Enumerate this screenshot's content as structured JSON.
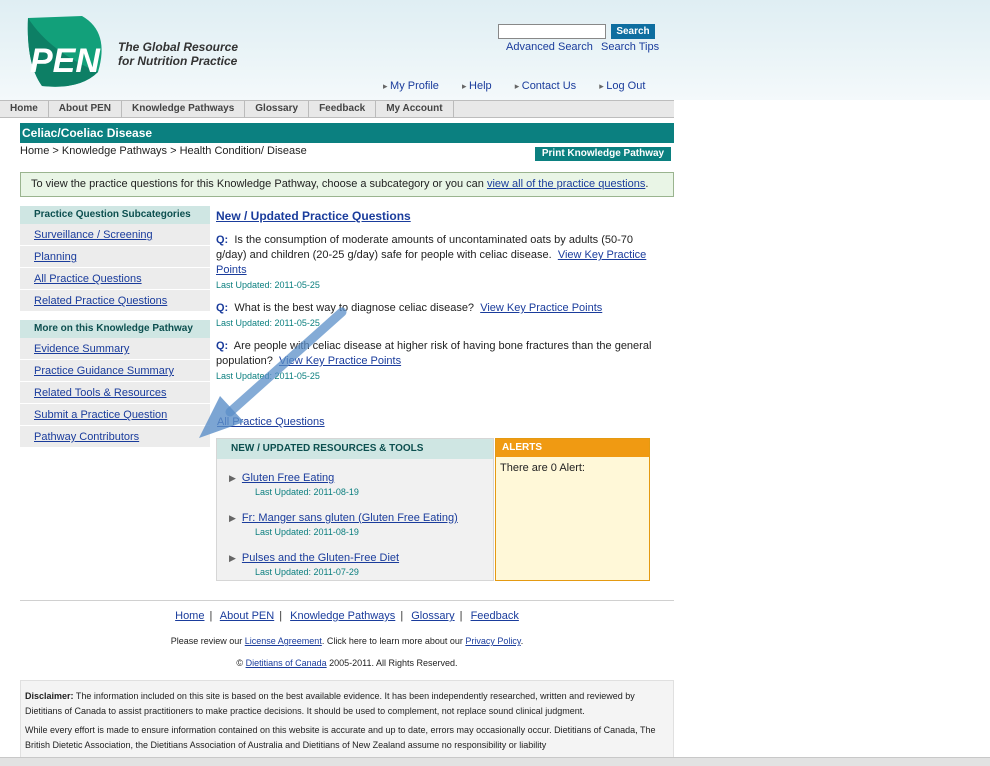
{
  "header": {
    "logo_text": "PEN",
    "tagline_line1": "The Global Resource",
    "tagline_line2": "for Nutrition Practice",
    "search_button": "Search",
    "advanced_search": "Advanced Search",
    "search_tips": "Search Tips",
    "user_links": [
      "My Profile",
      "Help",
      "Contact Us",
      "Log Out"
    ]
  },
  "nav": {
    "tabs": [
      "Home",
      "About PEN",
      "Knowledge Pathways",
      "Glossary",
      "Feedback",
      "My Account"
    ]
  },
  "page": {
    "title": "Celiac/Coeliac Disease",
    "breadcrumb": "Home > Knowledge Pathways > Health Condition/ Disease",
    "print_button": "Print Knowledge Pathway",
    "notice_prefix": "To view the practice questions for this Knowledge Pathway, choose a subcategory or you can ",
    "notice_link": "view all of the practice questions",
    "notice_suffix": "."
  },
  "sidebar": {
    "section1_title": "Practice Question Subcategories",
    "section1_items": [
      "Surveillance / Screening",
      "Planning",
      "All Practice Questions",
      "Related Practice Questions"
    ],
    "section2_title": "More on this Knowledge Pathway",
    "section2_items": [
      "Evidence Summary",
      "Practice Guidance Summary",
      "Related Tools & Resources",
      "Submit a Practice Question",
      "Pathway Contributors"
    ]
  },
  "main": {
    "title": "New / Updated Practice Questions",
    "q_label": "Q:",
    "questions": [
      {
        "text": "Is the consumption of moderate amounts of uncontaminated oats by adults (50-70 g/day) and children (20-25 g/day) safe for people with celiac disease.",
        "link": "View Key Practice Points",
        "date": "Last Updated: 2011-05-25"
      },
      {
        "text": "What is the best way to diagnose celiac disease?",
        "link": "View Key Practice Points",
        "date": "Last Updated: 2011-05-25"
      },
      {
        "text": "Are people with celiac disease at higher risk of having bone fractures than the general population?",
        "link": "View Key Practice Points",
        "date": "Last Updated: 2011-05-25"
      }
    ],
    "all_questions_link": "All Practice Questions"
  },
  "resources": {
    "title": "NEW / UPDATED RESOURCES & TOOLS",
    "items": [
      {
        "label": "Gluten Free Eating",
        "date": "Last Updated: 2011-08-19"
      },
      {
        "label": "Fr: Manger sans gluten (Gluten Free Eating)",
        "date": "Last Updated: 2011-08-19"
      },
      {
        "label": "Pulses and the Gluten-Free Diet",
        "date": "Last Updated: 2011-07-29"
      }
    ]
  },
  "alerts": {
    "title": "ALERTS",
    "text": "There are 0 Alert:"
  },
  "footer": {
    "links": [
      "Home",
      "About PEN",
      "Knowledge Pathways",
      "Glossary",
      "Feedback"
    ],
    "license_prefix": "Please review our ",
    "license_link": "License Agreement",
    "license_mid": ".  Click here to learn more about our ",
    "privacy_link": "Privacy Policy",
    "license_suffix": ".",
    "copyright_symbol": "©",
    "copyright_link": "Dietitians of Canada",
    "copyright_suffix": " 2005-2011.  All Rights Reserved."
  },
  "disclaimer": {
    "label": "Disclaimer:",
    "text1": " The information included on this site is based on the best available evidence. It has been independently researched, written and reviewed by Dietitians of Canada to assist practitioners to make practice decisions. It should be used to complement, not replace sound clinical judgment.",
    "text2": "While every effort is made to ensure information contained on this website is accurate and up to date, errors may occasionally occur. Dietitians of Canada, The British Dietetic Association, the Dietitians Association of Australia and Dietitians of New Zealand assume no responsibility or liability"
  },
  "colors": {
    "teal": "#0b8080",
    "link": "#1a3c9c",
    "alert_orange": "#f09a12",
    "overlay_arrow": "#5b8fc8"
  }
}
